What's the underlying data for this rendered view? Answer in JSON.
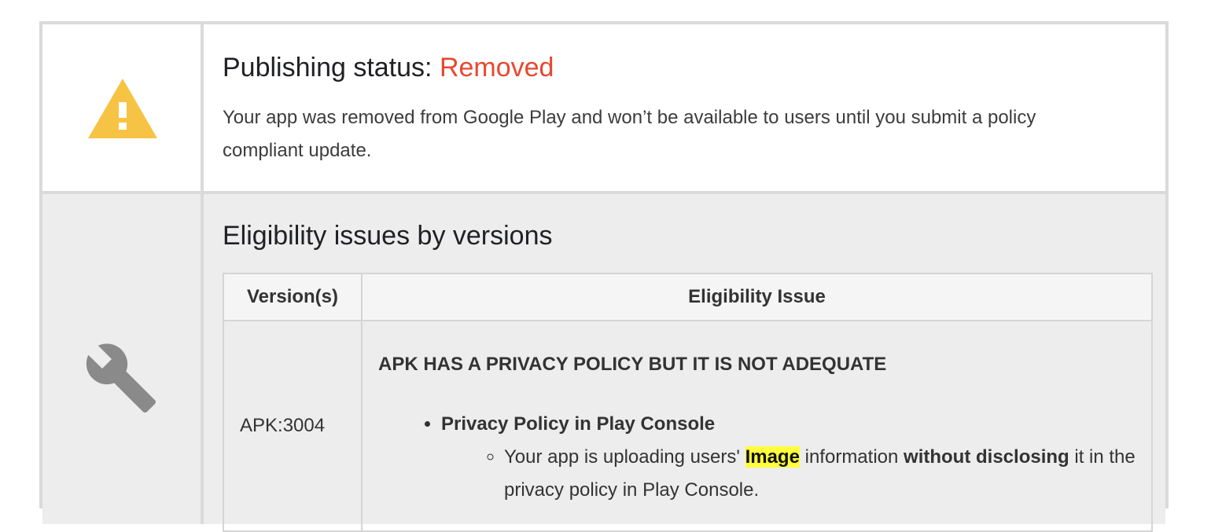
{
  "status": {
    "title_prefix": "Publishing status:",
    "title_value": "Removed",
    "description": "Your app was removed from Google Play and won’t be available to users until you submit a policy compliant update."
  },
  "eligibility": {
    "title": "Eligibility issues by versions",
    "columns": [
      "Version(s)",
      "Eligibility Issue"
    ],
    "rows": [
      {
        "version": "APK:3004",
        "issue_heading": "APK HAS A PRIVACY POLICY BUT IT IS NOT ADEQUATE",
        "bullet": "Privacy Policy in Play Console",
        "sub_part1": "Your app is uploading users'",
        "sub_highlight": "Image",
        "sub_part2": "information",
        "sub_strong": "without disclosing",
        "sub_part3": "it in the privacy policy in Play Console."
      }
    ]
  },
  "colors": {
    "removed": "#e8472f",
    "warning_icon": "#f6c344",
    "wrench_icon": "#8a8a8a",
    "highlight": "#ffff3c"
  },
  "icons": [
    "warning-icon",
    "wrench-icon"
  ]
}
